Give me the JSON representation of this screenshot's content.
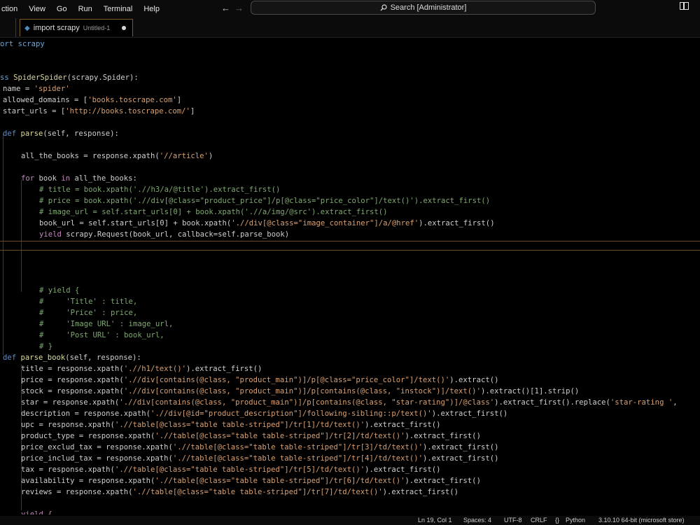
{
  "menu": [
    "ction",
    "View",
    "Go",
    "Run",
    "Terminal",
    "Help"
  ],
  "search": {
    "label": "Search [Administrator]"
  },
  "tab": {
    "name": "import scrapy",
    "subtitle": "Untitled-1"
  },
  "editor": {
    "lines": [
      [
        [
          "ort scrapy",
          "#6ea6d6"
        ]
      ],
      [],
      [],
      [
        [
          "ss ",
          "#6ea6d6"
        ],
        [
          "SpiderSpider",
          "#d8d4a0"
        ],
        [
          "(scrapy.Spider):",
          "#cfcfcf"
        ]
      ],
      [
        [
          "name = ",
          "#cfcfcf"
        ],
        [
          "'spider'",
          "#d8a070"
        ]
      ],
      [
        [
          "allowed_domains = [",
          "#cfcfcf"
        ],
        [
          "'books.toscrape.com'",
          "#d8a070"
        ],
        [
          "]",
          "#cfcfcf"
        ]
      ],
      [
        [
          "start_urls = [",
          "#cfcfcf"
        ],
        [
          "'http://books.toscrape.com/'",
          "#d8a070"
        ],
        [
          "]",
          "#cfcfcf"
        ]
      ],
      [],
      [
        [
          "def ",
          "#5a8cd0"
        ],
        [
          "parse",
          "#dcdca0"
        ],
        [
          "(self, response):",
          "#cfcfcf"
        ]
      ],
      [],
      [
        [
          "all_the_books = response.xpath(",
          "#cfcfcf"
        ],
        [
          "'//article'",
          "#d8a070"
        ],
        [
          ")",
          "#cfcfcf"
        ]
      ],
      [],
      [
        [
          "for ",
          "#c586c0"
        ],
        [
          "book ",
          "#cfcfcf"
        ],
        [
          "in ",
          "#c586c0"
        ],
        [
          "all_the_books:",
          "#cfcfcf"
        ]
      ],
      [
        [
          "# title = book.xpath('.//h3/a/@title').extract_first()",
          "#7fa870"
        ]
      ],
      [
        [
          "# price = book.xpath('.//div[@class=\"product_price\"]/p[@class=\"price_color\"]/text()').extract_first()",
          "#7fa870"
        ]
      ],
      [
        [
          "# image_url = self.start_urls[0] + book.xpath('.//a/img/@src').extract_first()",
          "#7fa870"
        ]
      ],
      [
        [
          "book_url = self.start_urls[0] + book.xpath(",
          "#cfcfcf"
        ],
        [
          "'.//div[@class=\"image_container\"]/a/@href'",
          "#d8a070"
        ],
        [
          ").extract_first()",
          "#cfcfcf"
        ]
      ],
      [
        [
          "yield ",
          "#c586c0"
        ],
        [
          "scrapy.Request(book_url, callback=self.parse_book)",
          "#cfcfcf"
        ]
      ],
      [],
      [],
      [],
      [],
      [
        [
          "# yield {",
          "#7fa870"
        ]
      ],
      [
        [
          "#     'Title' : title,",
          "#7fa870"
        ]
      ],
      [
        [
          "#     'Price' : price,",
          "#7fa870"
        ]
      ],
      [
        [
          "#     'Image URL' : image_url,",
          "#7fa870"
        ]
      ],
      [
        [
          "#     'Post URL' : book_url,",
          "#7fa870"
        ]
      ],
      [
        [
          "# }",
          "#7fa870"
        ]
      ],
      [
        [
          "def ",
          "#5a8cd0"
        ],
        [
          "parse_book",
          "#dcdca0"
        ],
        [
          "(self, response):",
          "#cfcfcf"
        ]
      ],
      [
        [
          "title = response.xpath(",
          "#cfcfcf"
        ],
        [
          "'.//h1/text()'",
          "#d8a070"
        ],
        [
          ").extract_first()",
          "#cfcfcf"
        ]
      ],
      [
        [
          "price = response.xpath(",
          "#cfcfcf"
        ],
        [
          "'.//div[contains(@class, \"product_main\")]/p[@class=\"price_color\"]/text()'",
          "#d8a070"
        ],
        [
          ").extract()",
          "#cfcfcf"
        ]
      ],
      [
        [
          "stock = response.xpath(",
          "#cfcfcf"
        ],
        [
          "'.//div[contains(@class, \"product_main\")]/p[contains(@class, \"instock\")]/text()'",
          "#d8a070"
        ],
        [
          ").extract()[1].strip()",
          "#cfcfcf"
        ]
      ],
      [
        [
          "star = response.xpath(",
          "#cfcfcf"
        ],
        [
          "'.//div[contains(@class, \"product_main\")]/p[contains(@class, \"star-rating\")]/@class'",
          "#d8a070"
        ],
        [
          ").extract_first().replace(",
          "#cfcfcf"
        ],
        [
          "'star-rating '",
          "#d8a070"
        ],
        [
          ",",
          "#cfcfcf"
        ]
      ],
      [
        [
          "description = response.xpath(",
          "#cfcfcf"
        ],
        [
          "'.//div[@id=\"product_description\"]/following-sibling::p/text()'",
          "#d8a070"
        ],
        [
          ").extract_first()",
          "#cfcfcf"
        ]
      ],
      [
        [
          "upc = response.xpath(",
          "#cfcfcf"
        ],
        [
          "'.//table[@class=\"table table-striped\"]/tr[1]/td/text()'",
          "#d8a070"
        ],
        [
          ").extract_first()",
          "#cfcfcf"
        ]
      ],
      [
        [
          "product_type = response.xpath(",
          "#cfcfcf"
        ],
        [
          "'.//table[@class=\"table table-striped\"]/tr[2]/td/text()'",
          "#d8a070"
        ],
        [
          ").extract_first()",
          "#cfcfcf"
        ]
      ],
      [
        [
          "price_exclud_tax = response.xpath(",
          "#cfcfcf"
        ],
        [
          "'.//table[@class=\"table table-striped\"]/tr[3]/td/text()'",
          "#d8a070"
        ],
        [
          ").extract_first()",
          "#cfcfcf"
        ]
      ],
      [
        [
          "price_includ_tax = response.xpath(",
          "#cfcfcf"
        ],
        [
          "'.//table[@class=\"table table-striped\"]/tr[4]/td/text()'",
          "#d8a070"
        ],
        [
          ").extract_first()",
          "#cfcfcf"
        ]
      ],
      [
        [
          "tax = response.xpath(",
          "#cfcfcf"
        ],
        [
          "'.//table[@class=\"table table-striped\"]/tr[5]/td/text()'",
          "#d8a070"
        ],
        [
          ").extract_first()",
          "#cfcfcf"
        ]
      ],
      [
        [
          "availability = response.xpath(",
          "#cfcfcf"
        ],
        [
          "'.//table[@class=\"table table-striped\"]/tr[6]/td/text()'",
          "#d8a070"
        ],
        [
          ").extract_first()",
          "#cfcfcf"
        ]
      ],
      [
        [
          "reviews = response.xpath(",
          "#cfcfcf"
        ],
        [
          "'.//table[@class=\"table table-striped\"]/tr[7]/td/text()'",
          "#d8a070"
        ],
        [
          ").extract_first()",
          "#cfcfcf"
        ]
      ],
      [],
      [
        [
          "yield {",
          "#c586c0"
        ]
      ]
    ]
  },
  "status": {
    "position": "Ln 19, Col 1",
    "spaces": "Spaces: 4",
    "encoding": "UTF-8",
    "eol": "CRLF",
    "language": "Python",
    "interpreter": "3.10.10 64-bit (microsoft store)"
  },
  "colors": {
    "background": "#000000",
    "text": "#cfcfcf",
    "keyword_def": "#5a8cd0",
    "keyword_control": "#c586c0",
    "string": "#d8a070",
    "comment": "#7fa870",
    "function": "#dcdca0",
    "current_line_border": "#6b4a23"
  }
}
